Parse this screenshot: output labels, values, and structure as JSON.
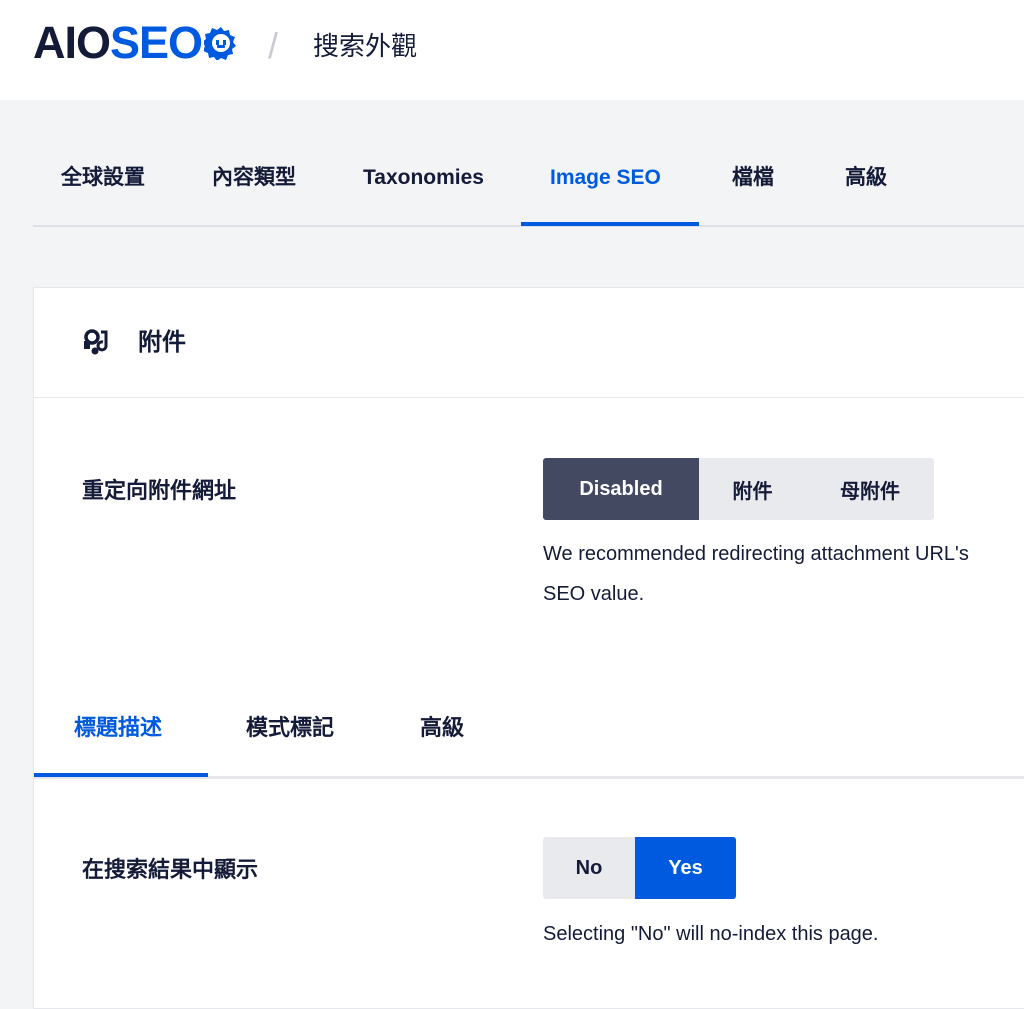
{
  "header": {
    "logo_aio": "AIO",
    "logo_seo": "SEO",
    "separator": "/",
    "title": "搜索外觀"
  },
  "main_tabs": [
    {
      "label": "全球設置",
      "active": false
    },
    {
      "label": "內容類型",
      "active": false
    },
    {
      "label": "Taxonomies",
      "active": false
    },
    {
      "label": "Image SEO",
      "active": true
    },
    {
      "label": "檔檔",
      "active": false
    },
    {
      "label": "高級",
      "active": false
    }
  ],
  "card": {
    "icon": "attachment-icon",
    "title": "附件"
  },
  "redirect": {
    "label": "重定向附件網址",
    "options": [
      {
        "label": "Disabled",
        "selected": true
      },
      {
        "label": "附件",
        "selected": false
      },
      {
        "label": "母附件",
        "selected": false
      }
    ],
    "description_line1": "We recommended redirecting attachment URL's",
    "description_line2": "SEO value."
  },
  "sub_tabs": [
    {
      "label": "標題描述",
      "active": true
    },
    {
      "label": "模式標記",
      "active": false
    },
    {
      "label": "高級",
      "active": false
    }
  ],
  "show_in_search": {
    "label": "在搜索結果中顯示",
    "options": [
      {
        "label": "No",
        "selected": false
      },
      {
        "label": "Yes",
        "selected": true
      }
    ],
    "description": "Selecting \"No\" will no-index this page."
  },
  "colors": {
    "accent": "#005ae0",
    "dark": "#141b38",
    "selected_dark": "#434960",
    "button_bg": "#e9eaed"
  }
}
